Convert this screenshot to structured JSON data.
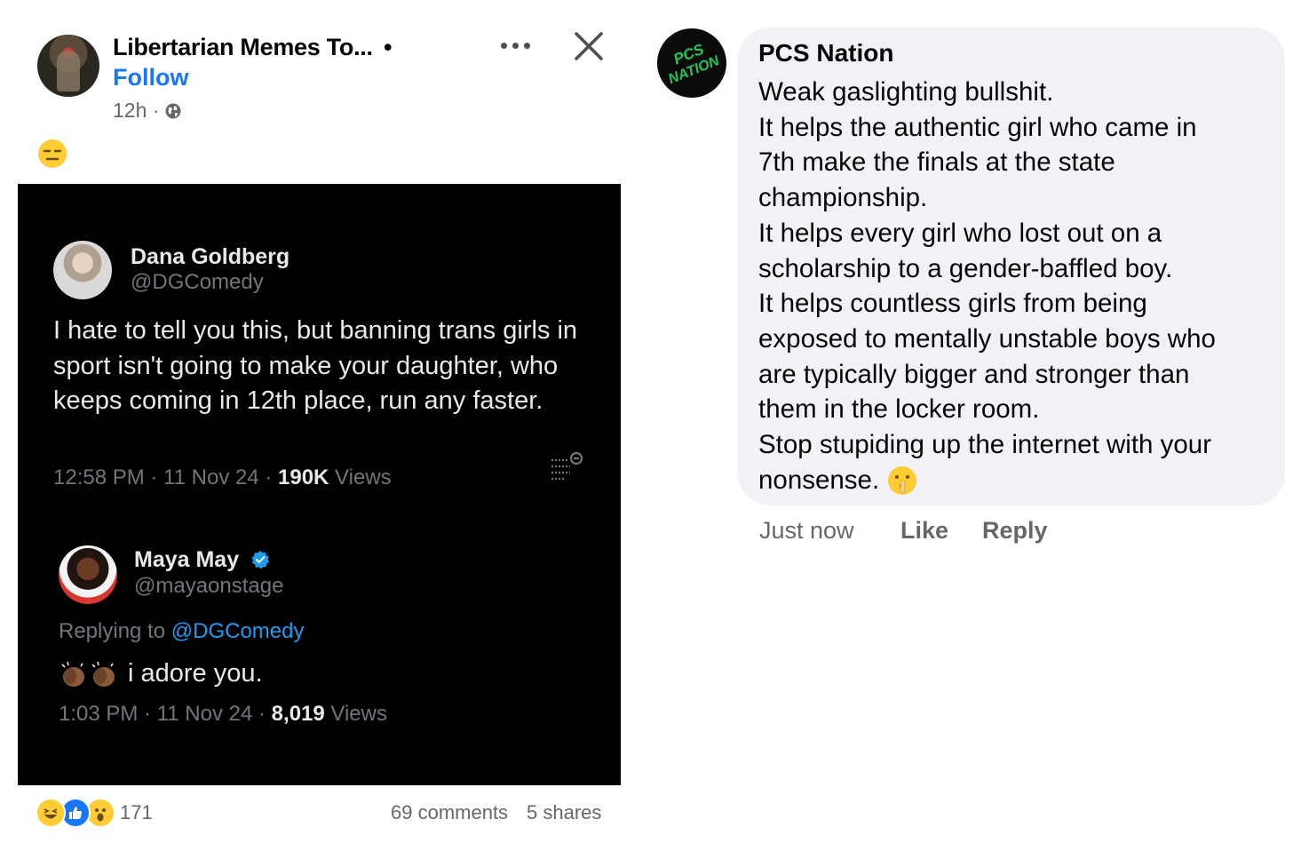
{
  "post": {
    "page_name": "Libertarian Memes To...",
    "separator": "•",
    "follow_label": "Follow",
    "time": "12h ·",
    "audience_icon": "globe-icon",
    "text_emoji": "expressionless-face-emoji",
    "more_icon": "more-options-icon",
    "close_icon": "close-icon"
  },
  "tweets": [
    {
      "name": "Dana Goldberg",
      "handle": "@DGComedy",
      "body": "I hate to tell you this, but banning trans girls in sport isn't going to make your daughter, who keeps coming in 12th place, run any faster.",
      "time": "12:58 PM · 11 Nov 24 · ",
      "views_count": "190K",
      "views_label": " Views"
    },
    {
      "name": "Maya May",
      "handle": "@mayaonstage",
      "replying_prefix": "Replying to ",
      "replying_to": "@DGComedy",
      "body": "i adore you.",
      "time": "1:03 PM · 11 Nov 24 · ",
      "views_count": "8,019",
      "views_label": " Views"
    }
  ],
  "footer": {
    "reaction_count": "171",
    "comments": "69 comments",
    "shares": "5 shares",
    "reactions": [
      "laugh-reaction-icon",
      "like-reaction-icon",
      "wow-reaction-icon"
    ]
  },
  "comment": {
    "author": "PCS Nation",
    "lines": [
      "Weak gaslighting bullshit.",
      "It helps the authentic girl who came in",
      "7th make the finals at the state",
      "championship.",
      "It helps every girl who lost out on a",
      "scholarship to a gender-baffled boy.",
      "It helps countless girls from being",
      "exposed to mentally unstable boys who",
      "are typically bigger and stronger than",
      "them in the locker room.",
      "Stop stupiding up the internet with your",
      "nonsense."
    ],
    "time": "Just now",
    "like_label": "Like",
    "reply_label": "Reply",
    "avatar_text": "PCS NATION"
  },
  "colors": {
    "facebook_blue": "#1877f2",
    "twitter_blue": "#1d9bf0",
    "bubble_bg": "#f0f2f5",
    "muted_text": "#65676b",
    "avatar_green": "#22c55e"
  }
}
